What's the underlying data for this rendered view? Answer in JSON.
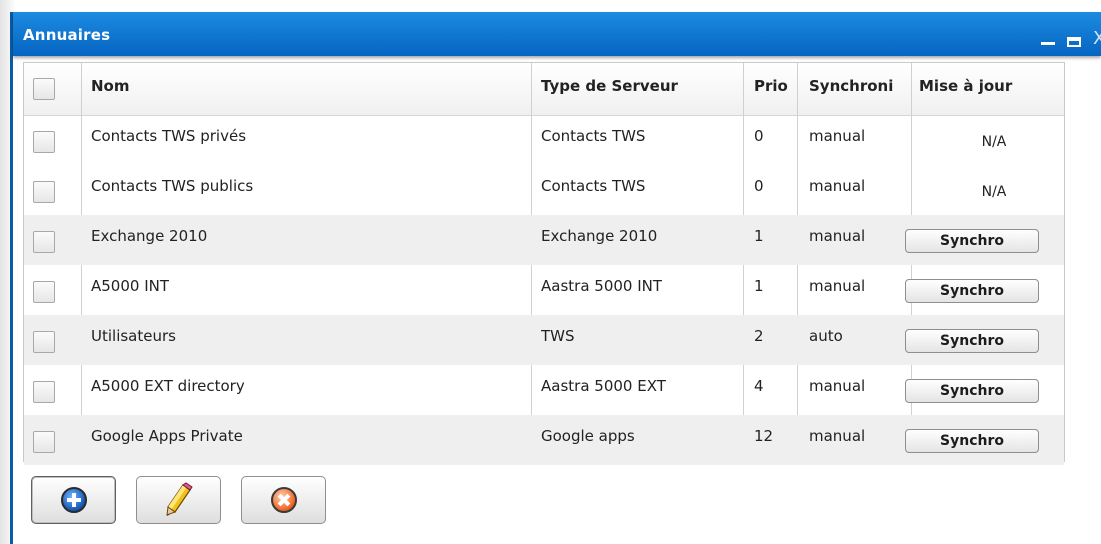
{
  "window": {
    "title": "Annuaires",
    "min_glyph": "_",
    "close_glyph": "X"
  },
  "table": {
    "columns": [
      "Nom",
      "Type de Serveur",
      "Prio",
      "Synchroni",
      "Mise à jour"
    ],
    "rows": [
      {
        "nom": "Contacts TWS privés",
        "type": "Contacts TWS",
        "prio": "0",
        "sync": "manual",
        "maj": "N/A"
      },
      {
        "nom": "Contacts TWS publics",
        "type": "Contacts TWS",
        "prio": "0",
        "sync": "manual",
        "maj": "N/A"
      },
      {
        "nom": "Exchange 2010",
        "type": "Exchange 2010",
        "prio": "1",
        "sync": "manual",
        "maj": "Synchro"
      },
      {
        "nom": "A5000 INT",
        "type": "Aastra 5000 INT",
        "prio": "1",
        "sync": "manual",
        "maj": "Synchro"
      },
      {
        "nom": "Utilisateurs",
        "type": "TWS",
        "prio": "2",
        "sync": "auto",
        "maj": "Synchro"
      },
      {
        "nom": "A5000 EXT directory",
        "type": "Aastra 5000 EXT",
        "prio": "4",
        "sync": "manual",
        "maj": "Synchro"
      },
      {
        "nom": "Google Apps Private",
        "type": "Google apps",
        "prio": "12",
        "sync": "manual",
        "maj": "Synchro"
      }
    ]
  },
  "toolbar": {
    "icons": [
      "add-icon",
      "pencil-icon",
      "delete-icon"
    ]
  },
  "colors": {
    "titlebar": "#0a6dc8",
    "alt_row": "#efefef"
  }
}
